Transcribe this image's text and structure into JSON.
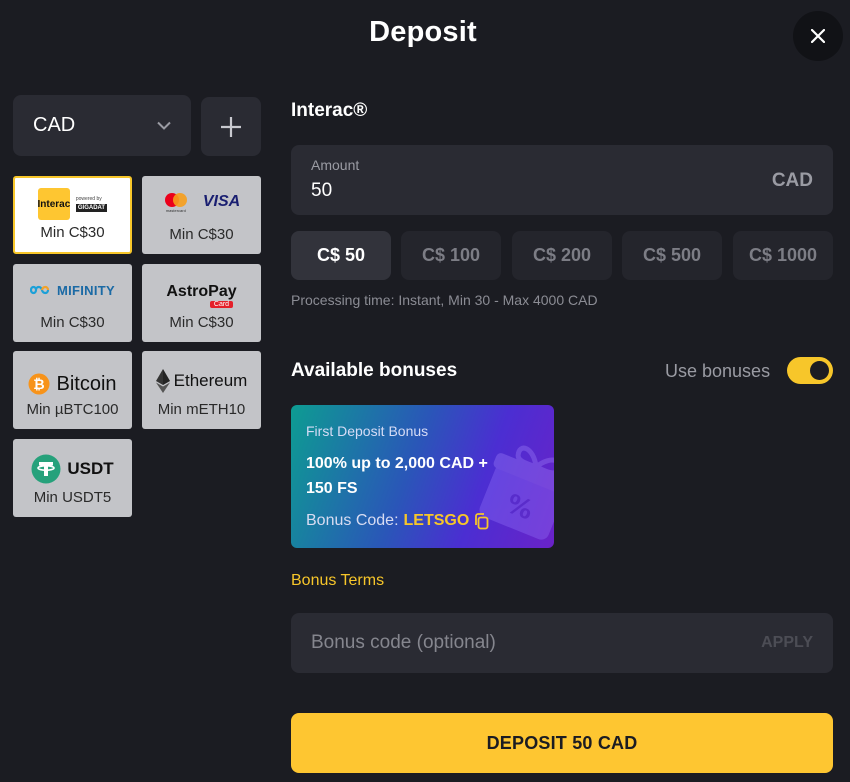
{
  "header": {
    "title": "Deposit",
    "close_icon": "close-icon"
  },
  "currency": {
    "selected": "CAD",
    "add_icon": "plus-icon"
  },
  "methods": [
    {
      "name": "interac",
      "logo_text": "Interac",
      "logo_sub": "powered by",
      "logo_sub2": "GIGADAT",
      "min": "Min C$30"
    },
    {
      "name": "cards",
      "logo_text": "VISA",
      "logo_sub": "mastercard",
      "min": "Min C$30"
    },
    {
      "name": "mifinity",
      "logo_text": "MIFINITY",
      "min": "Min C$30"
    },
    {
      "name": "astropay",
      "logo_text": "AstroPay",
      "logo_sub": "Card",
      "min": "Min C$30"
    },
    {
      "name": "bitcoin",
      "logo_text": "Bitcoin",
      "min": "Min µBTC100"
    },
    {
      "name": "ethereum",
      "logo_text": "Ethereum",
      "min": "Min mETH10"
    },
    {
      "name": "usdt",
      "logo_text": "USDT",
      "min": "Min USDT5"
    }
  ],
  "selected_method": {
    "title": "Interac®"
  },
  "amount": {
    "label": "Amount",
    "value": "50",
    "currency": "CAD"
  },
  "presets": [
    "C$ 50",
    "C$ 100",
    "C$ 200",
    "C$ 500",
    "C$ 1000"
  ],
  "processing": "Processing time: Instant, Min 30 - Max 4000 CAD",
  "bonuses": {
    "title": "Available bonuses",
    "use_label": "Use bonuses",
    "use_enabled": true,
    "card": {
      "kicker": "First Deposit Bonus",
      "headline": "100% up to 2,000 CAD + 150 FS",
      "code_label": "Bonus Code:",
      "code": "LETSGO"
    },
    "terms_link": "Bonus Terms"
  },
  "bonus_code_input": {
    "placeholder": "Bonus code (optional)",
    "apply_label": "APPLY"
  },
  "deposit_button": "DEPOSIT 50 CAD",
  "colors": {
    "accent": "#fec631",
    "background": "#1b1c22",
    "panel": "#2a2b33"
  }
}
